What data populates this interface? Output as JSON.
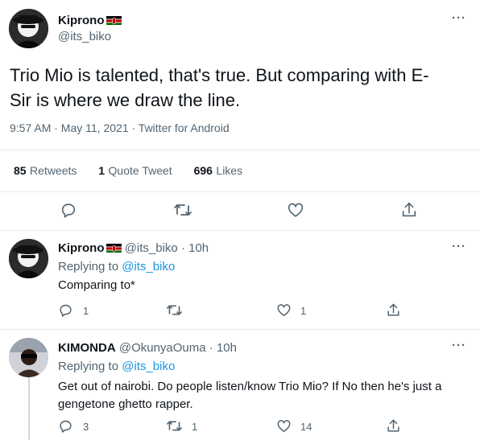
{
  "main_tweet": {
    "author_name": "Kiprono",
    "author_handle": "@its_biko",
    "text_line1": "Trio Mio is talented, that's true. But comparing with E-",
    "text_line2": "Sir is where we draw the line.",
    "meta": "9:57 AM · May 11, 2021 · Twitter for Android",
    "retweets_count": "85",
    "retweets_label": "Retweets",
    "quotes_count": "1",
    "quotes_label": "Quote Tweet",
    "likes_count": "696",
    "likes_label": "Likes"
  },
  "replies": [
    {
      "author_name": "Kiprono",
      "author_handle": "@its_biko",
      "time": "· 10h",
      "replying_prefix": "Replying to",
      "replying_to": "@its_biko",
      "text_line1": "Comparing to*",
      "text_line2": "",
      "reply_count": "1",
      "retweet_count": "",
      "like_count": "1"
    },
    {
      "author_name": "KIMONDA",
      "author_handle": "@OkunyaOuma",
      "time": "· 10h",
      "replying_prefix": "Replying to",
      "replying_to": "@its_biko",
      "text_line1": "Get out of nairobi. Do people listen/know Trio Mio?  If No then he's just a",
      "text_line2": "gengetone ghetto rapper.",
      "reply_count": "3",
      "retweet_count": "1",
      "like_count": "14"
    }
  ],
  "colors": {
    "accent": "#1b95e0",
    "muted": "#536471",
    "divider": "#e6ecf0",
    "text": "#0f1419"
  },
  "icons": [
    "reply-icon",
    "retweet-icon",
    "like-icon",
    "share-icon",
    "more-icon",
    "kenya-flag-icon"
  ]
}
